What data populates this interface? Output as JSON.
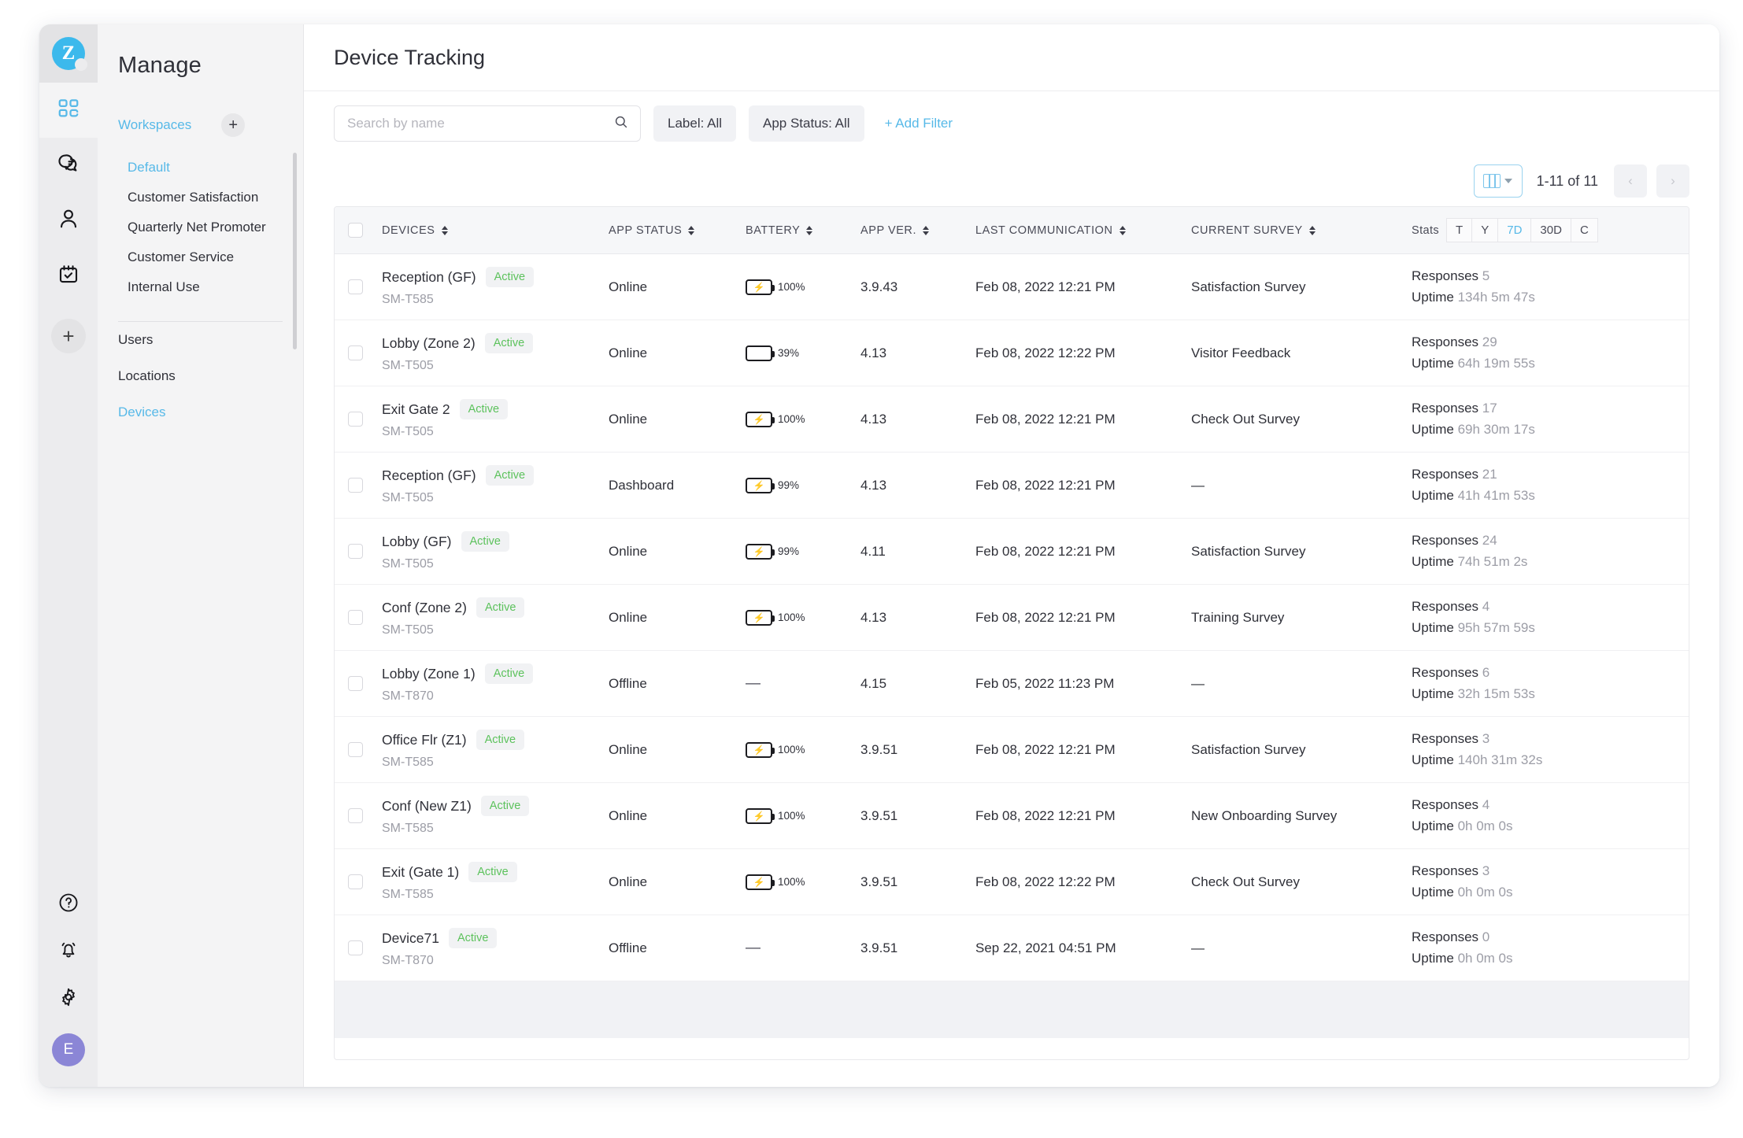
{
  "rail": {
    "logo": "Z",
    "items": [
      {
        "name": "apps-grid-icon",
        "active": true
      },
      {
        "name": "chat-bubbles-icon",
        "active": false
      },
      {
        "name": "user-icon",
        "active": false
      },
      {
        "name": "calendar-check-icon",
        "active": false
      }
    ],
    "add_label": "+",
    "bottom": [
      {
        "name": "help-circle-icon"
      },
      {
        "name": "bell-icon"
      },
      {
        "name": "gear-icon"
      }
    ],
    "avatar_initial": "E"
  },
  "sidebar": {
    "title": "Manage",
    "workspaces_label": "Workspaces",
    "workspaces_add": "+",
    "workspaces": [
      {
        "label": "Default",
        "selected": true
      },
      {
        "label": "Customer Satisfaction",
        "selected": false
      },
      {
        "label": "Quarterly Net Promoter",
        "selected": false
      },
      {
        "label": "Customer Service",
        "selected": false
      },
      {
        "label": "Internal Use",
        "selected": false
      }
    ],
    "links": [
      {
        "label": "Users",
        "selected": false
      },
      {
        "label": "Locations",
        "selected": false
      },
      {
        "label": "Devices",
        "selected": true
      }
    ]
  },
  "header": {
    "title": "Device Tracking"
  },
  "toolbar": {
    "search_placeholder": "Search by name",
    "search_value": "",
    "search_icon": "search-icon",
    "filters": [
      {
        "label": "Label: All"
      },
      {
        "label": "App Status: All"
      }
    ],
    "add_filter": "+ Add Filter"
  },
  "table_toolbar": {
    "columns_icon": "columns-icon",
    "chevron": "chevron-down-icon",
    "range": "1-11 of 11",
    "prev": "‹",
    "next": "›"
  },
  "columns": {
    "devices": "DEVICES",
    "app_status": "APP STATUS",
    "battery": "BATTERY",
    "app_ver": "APP VER.",
    "last_communication": "LAST COMMUNICATION",
    "current_survey": "CURRENT SURVEY",
    "stats": "Stats"
  },
  "stats_ranges": [
    {
      "label": "T",
      "active": false
    },
    {
      "label": "Y",
      "active": false
    },
    {
      "label": "7D",
      "active": true
    },
    {
      "label": "30D",
      "active": false
    },
    {
      "label": "C",
      "active": false
    }
  ],
  "labels": {
    "responses": "Responses",
    "uptime": "Uptime",
    "empty": "—"
  },
  "rows": [
    {
      "name": "Reception (GF)",
      "badge": "Active",
      "model": "SM-T585",
      "app_status": "Online",
      "battery_pct": 100,
      "battery_text": "100%",
      "charging": true,
      "app_ver": "3.9.43",
      "last_communication": "Feb 08, 2022 12:21 PM",
      "current_survey": "Satisfaction Survey",
      "responses": "5",
      "uptime": "134h 5m 47s"
    },
    {
      "name": "Lobby (Zone 2)",
      "badge": "Active",
      "model": "SM-T505",
      "app_status": "Online",
      "battery_pct": 39,
      "battery_text": "39%",
      "charging": false,
      "app_ver": "4.13",
      "last_communication": "Feb 08, 2022 12:22 PM",
      "current_survey": "Visitor Feedback",
      "responses": "29",
      "uptime": "64h 19m 55s"
    },
    {
      "name": "Exit Gate 2",
      "badge": "Active",
      "model": "SM-T505",
      "app_status": "Online",
      "battery_pct": 100,
      "battery_text": "100%",
      "charging": true,
      "app_ver": "4.13",
      "last_communication": "Feb 08, 2022 12:21 PM",
      "current_survey": "Check Out Survey",
      "responses": "17",
      "uptime": "69h 30m 17s"
    },
    {
      "name": "Reception (GF)",
      "badge": "Active",
      "model": "SM-T505",
      "app_status": "Dashboard",
      "battery_pct": 99,
      "battery_text": "99%",
      "charging": true,
      "app_ver": "4.13",
      "last_communication": "Feb 08, 2022 12:21 PM",
      "current_survey": "—",
      "responses": "21",
      "uptime": "41h 41m 53s"
    },
    {
      "name": "Lobby (GF)",
      "badge": "Active",
      "model": "SM-T505",
      "app_status": "Online",
      "battery_pct": 99,
      "battery_text": "99%",
      "charging": true,
      "app_ver": "4.11",
      "last_communication": "Feb 08, 2022 12:21 PM",
      "current_survey": "Satisfaction Survey",
      "responses": "24",
      "uptime": "74h 51m 2s"
    },
    {
      "name": "Conf (Zone 2)",
      "badge": "Active",
      "model": "SM-T505",
      "app_status": "Online",
      "battery_pct": 100,
      "battery_text": "100%",
      "charging": true,
      "app_ver": "4.13",
      "last_communication": "Feb 08, 2022 12:21 PM",
      "current_survey": "Training Survey",
      "responses": "4",
      "uptime": "95h 57m 59s"
    },
    {
      "name": "Lobby (Zone 1)",
      "badge": "Active",
      "model": "SM-T870",
      "app_status": "Offline",
      "battery_pct": null,
      "battery_text": "—",
      "charging": false,
      "app_ver": "4.15",
      "last_communication": "Feb 05, 2022 11:23 PM",
      "current_survey": "—",
      "responses": "6",
      "uptime": "32h 15m 53s"
    },
    {
      "name": "Office Flr (Z1)",
      "badge": "Active",
      "model": "SM-T585",
      "app_status": "Online",
      "battery_pct": 100,
      "battery_text": "100%",
      "charging": true,
      "app_ver": "3.9.51",
      "last_communication": "Feb 08, 2022 12:21 PM",
      "current_survey": "Satisfaction Survey",
      "responses": "3",
      "uptime": "140h 31m 32s"
    },
    {
      "name": "Conf (New Z1)",
      "badge": "Active",
      "model": "SM-T585",
      "app_status": "Online",
      "battery_pct": 100,
      "battery_text": "100%",
      "charging": true,
      "app_ver": "3.9.51",
      "last_communication": "Feb 08, 2022 12:21 PM",
      "current_survey": "New Onboarding Survey",
      "responses": "4",
      "uptime": "0h 0m 0s"
    },
    {
      "name": "Exit (Gate 1)",
      "badge": "Active",
      "model": "SM-T585",
      "app_status": "Online",
      "battery_pct": 100,
      "battery_text": "100%",
      "charging": true,
      "app_ver": "3.9.51",
      "last_communication": "Feb 08, 2022 12:22 PM",
      "current_survey": "Check Out Survey",
      "responses": "3",
      "uptime": "0h 0m 0s"
    },
    {
      "name": "Device71",
      "badge": "Active",
      "model": "SM-T870",
      "app_status": "Offline",
      "battery_pct": null,
      "battery_text": "—",
      "charging": false,
      "app_ver": "3.9.51",
      "last_communication": "Sep 22, 2021 04:51 PM",
      "current_survey": "—",
      "responses": "0",
      "uptime": "0h 0m 0s"
    }
  ],
  "colors": {
    "accent": "#57b9e8",
    "badge_green": "#5cc25c",
    "battery_green": "#4cd964",
    "avatar": "#8b86d6"
  }
}
